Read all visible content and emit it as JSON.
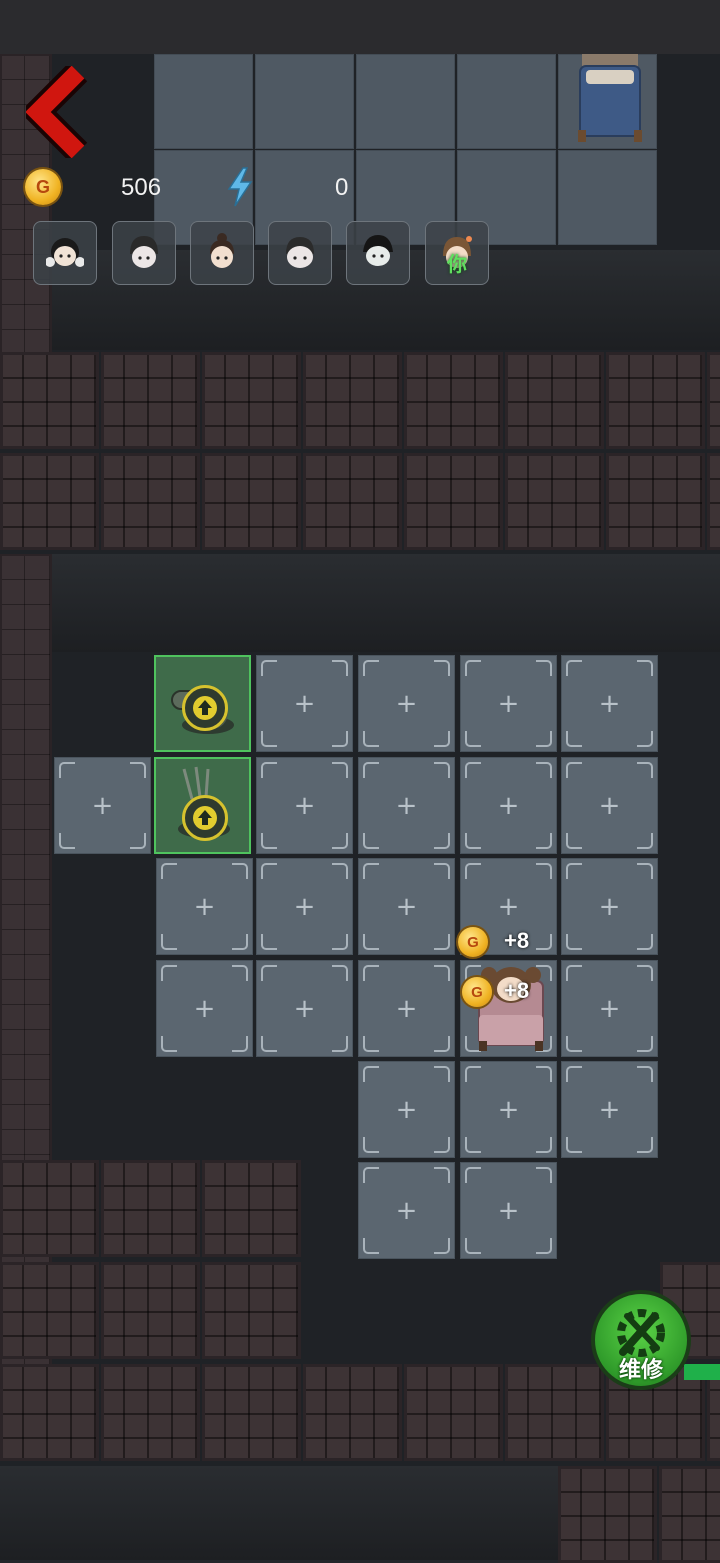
{
  "hud": {
    "coin_icon": "gold-coin-icon",
    "coin_symbol": "G",
    "coins": "506",
    "energy_icon": "lightning-icon",
    "energy": "0"
  },
  "players": [
    {
      "name": "player-avatar-1",
      "icon": "girl-pigtails-face-icon"
    },
    {
      "name": "player-avatar-2",
      "icon": "boy-face-icon"
    },
    {
      "name": "player-avatar-3",
      "icon": "girl-bun-face-icon"
    },
    {
      "name": "player-avatar-4",
      "icon": "child-face-icon"
    },
    {
      "name": "player-avatar-5",
      "icon": "boy-dark-hair-face-icon"
    },
    {
      "name": "player-avatar-you",
      "icon": "girl-brown-hair-face-icon",
      "label": "你"
    }
  ],
  "tile_symbol": "+",
  "income": [
    {
      "symbol": "G",
      "text": "+8"
    },
    {
      "symbol": "G",
      "text": "+8"
    }
  ],
  "repair_button": {
    "label": "维修",
    "icon": "wrench-gear-icon"
  },
  "colors": {
    "accent_green": "#4fc35e",
    "coin_gold": "#f0b323",
    "back_red": "#d0160f"
  }
}
